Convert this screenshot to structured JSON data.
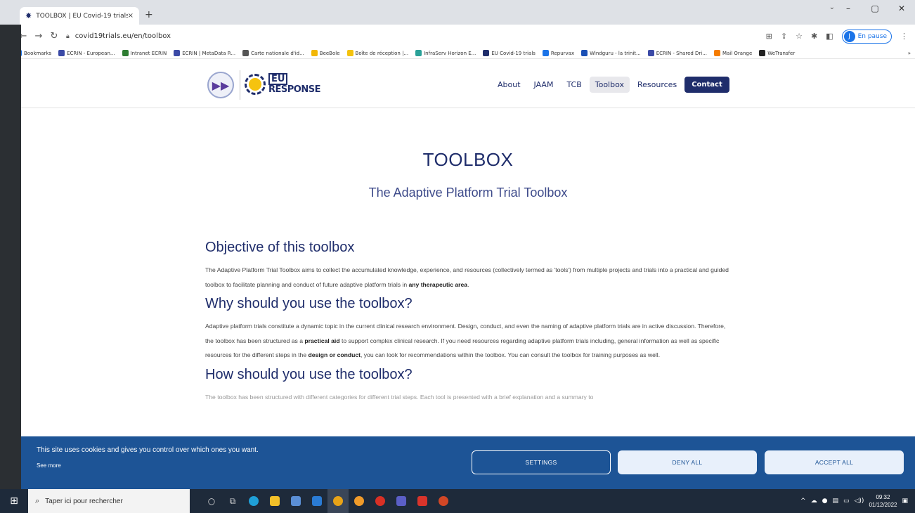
{
  "browser": {
    "tab_title": "TOOLBOX | EU Covid-19 trials",
    "tab_close": "×",
    "new_tab": "+",
    "url": "covid19trials.eu/en/toolbox",
    "profile_initial": "J",
    "profile_status": "En pause",
    "bookmarks": [
      {
        "label": "Bookmarks",
        "color": "#1a73e8"
      },
      {
        "label": "ECRIN - European...",
        "color": "#3b4aa6"
      },
      {
        "label": "Intranet ECRIN",
        "color": "#2e7d32"
      },
      {
        "label": "ECRIN | MetaData R...",
        "color": "#3b4aa6"
      },
      {
        "label": "Carte nationale d'id...",
        "color": "#555555"
      },
      {
        "label": "BeeBole",
        "color": "#f2b705"
      },
      {
        "label": "Boîte de réception |...",
        "color": "#f4c20d"
      },
      {
        "label": "InfraServ Horizon E...",
        "color": "#2aa198"
      },
      {
        "label": "EU Covid-19 trials",
        "color": "#1f2d6b"
      },
      {
        "label": "Repurvax",
        "color": "#1a73e8"
      },
      {
        "label": "Windguru - la trinit...",
        "color": "#1a4fb5"
      },
      {
        "label": "ECRIN - Shared Dri...",
        "color": "#3b4aa6"
      },
      {
        "label": "Mail Orange",
        "color": "#f57c00"
      },
      {
        "label": "WeTransfer",
        "color": "#222222"
      }
    ],
    "bookmarks_more": "»"
  },
  "site": {
    "logo_eu": "EU",
    "logo_response": "RESPONSE",
    "nav": [
      {
        "label": "About"
      },
      {
        "label": "JAAM"
      },
      {
        "label": "TCB"
      },
      {
        "label": "Toolbox"
      },
      {
        "label": "Resources"
      }
    ],
    "contact_label": "Contact"
  },
  "page": {
    "title": "TOOLBOX",
    "subtitle": "The Adaptive Platform Trial Toolbox",
    "sections": {
      "objective_heading": "Objective of this toolbox",
      "objective_text_1": "The Adaptive Platform Trial Toolbox aims to collect the accumulated knowledge, experience, and resources (collectively termed as 'tools') from multiple projects and trials into a practical and guided toolbox to facilitate planning and conduct of future adaptive platform trials in ",
      "objective_bold": "any therapeutic area",
      "objective_end": ".",
      "why_heading": "Why should you use the toolbox?",
      "why_text_1": "Adaptive platform trials constitute a dynamic topic in the current clinical research environment. Design, conduct, and even the naming of adaptive platform trials are in active discussion. Therefore, the toolbox has been structured as a ",
      "why_bold_1": "practical aid",
      "why_text_2": " to support complex clinical research. If you need resources regarding adaptive platform trials including, general information as well as specific resources for the different steps in the ",
      "why_bold_2": "design or conduct",
      "why_text_3": ", you can look for recommendations within the toolbox. You can consult the toolbox for training purposes as well.",
      "how_heading": "How should you use the toolbox?",
      "how_partial": "The toolbox has been structured with different categories for different trial steps. Each tool is presented with a brief explanation and a summary to"
    }
  },
  "cookie_banner": {
    "message": "This site uses cookies and gives you control over which ones you want.",
    "see_more": "See more",
    "settings": "SETTINGS",
    "deny_all": "DENY ALL",
    "accept_all": "ACCEPT ALL"
  },
  "taskbar": {
    "search_placeholder": "Taper ici pour rechercher",
    "time": "09:32",
    "date": "01/12/2022"
  }
}
